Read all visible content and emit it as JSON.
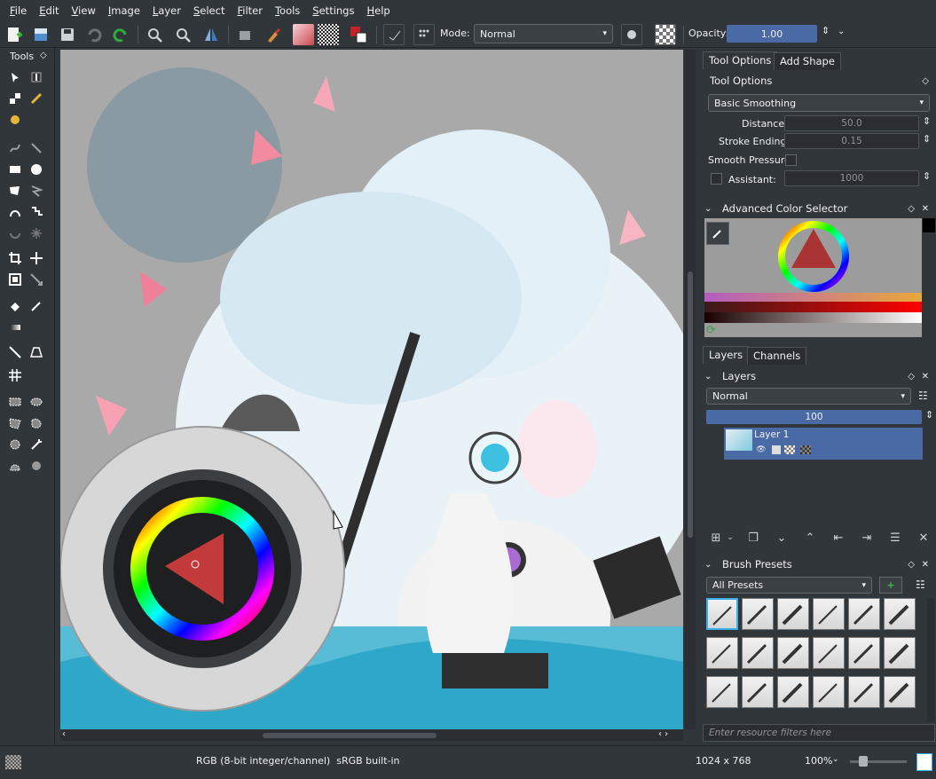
{
  "menubar": {
    "items": [
      "File",
      "Edit",
      "View",
      "Image",
      "Layer",
      "Select",
      "Filter",
      "Tools",
      "Settings",
      "Help"
    ]
  },
  "toolbar": {
    "mode_label": "Mode:",
    "mode_value": "Normal",
    "opacity_label": "Opacity:",
    "opacity_value": "1.00"
  },
  "toolbox": {
    "title": "Tools"
  },
  "dock": {
    "top_tabs": [
      "Tool Options",
      "Add Shape"
    ],
    "tool_options": {
      "title": "Tool Options",
      "smoothing": "Basic Smoothing",
      "distance_label": "Distance:",
      "distance_value": "50.0",
      "stroke_ending_label": "Stroke Ending:",
      "stroke_ending_value": "0.15",
      "smooth_pressure_label": "Smooth Pressure",
      "assistant_label": "Assistant:",
      "assistant_value": "1000"
    },
    "color_selector": {
      "title": "Advanced Color Selector"
    },
    "mid_tabs": [
      "Layers",
      "Channels"
    ],
    "layers": {
      "title": "Layers",
      "blend_mode": "Normal",
      "opacity": "100",
      "layer_name": "Layer 1"
    },
    "brush_presets": {
      "title": "Brush Presets",
      "filter": "All Presets",
      "search_placeholder": "Enter resource filters here"
    }
  },
  "statusbar": {
    "color_info": "RGB (8-bit integer/channel)  sRGB built-in",
    "dimensions": "1024 x 768",
    "zoom": "100%"
  },
  "colors": {
    "accent": "#3daee9",
    "bg": "#31363b",
    "selection": "#4a6aa5"
  }
}
